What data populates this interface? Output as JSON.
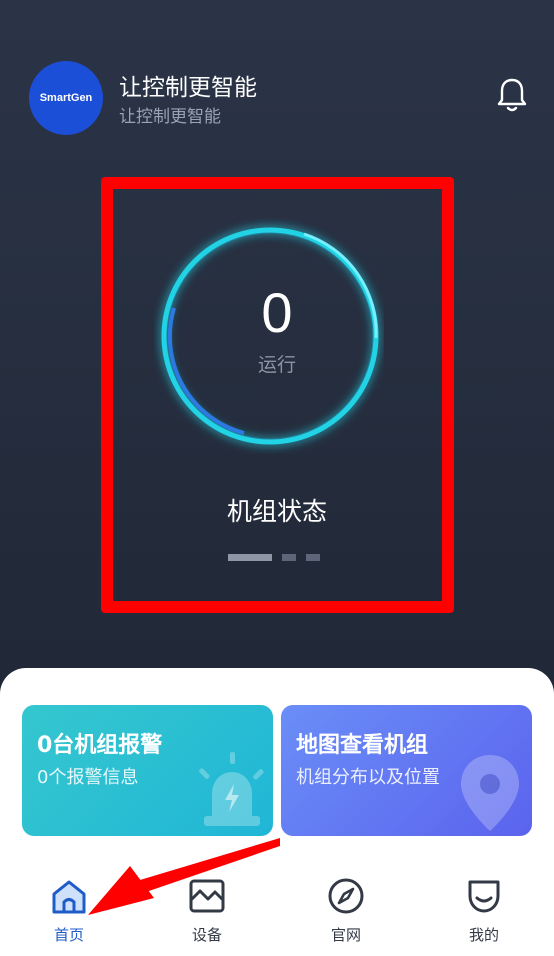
{
  "header": {
    "logo_text": "SmartGen",
    "title": "让控制更智能",
    "subtitle": "让控制更智能",
    "bell_icon": "bell-icon"
  },
  "status": {
    "count": "0",
    "count_label": "运行",
    "label": "机组状态",
    "carousel_page": 1,
    "carousel_total": 3
  },
  "cards": {
    "alarm": {
      "title": "0台机组报警",
      "subtitle": "0个报警信息",
      "icon": "alarm-light-icon"
    },
    "map": {
      "title": "地图查看机组",
      "subtitle": "机组分布以及位置",
      "icon": "map-pin-icon"
    }
  },
  "tabs": [
    {
      "label": "首页",
      "icon": "home-icon",
      "active": true
    },
    {
      "label": "设备",
      "icon": "device-chart-icon",
      "active": false
    },
    {
      "label": "官网",
      "icon": "compass-icon",
      "active": false
    },
    {
      "label": "我的",
      "icon": "profile-smile-icon",
      "active": false
    }
  ],
  "colors": {
    "annotation": "#ff0000",
    "accent": "#1e5cc8",
    "ring": "#22d3e6"
  }
}
